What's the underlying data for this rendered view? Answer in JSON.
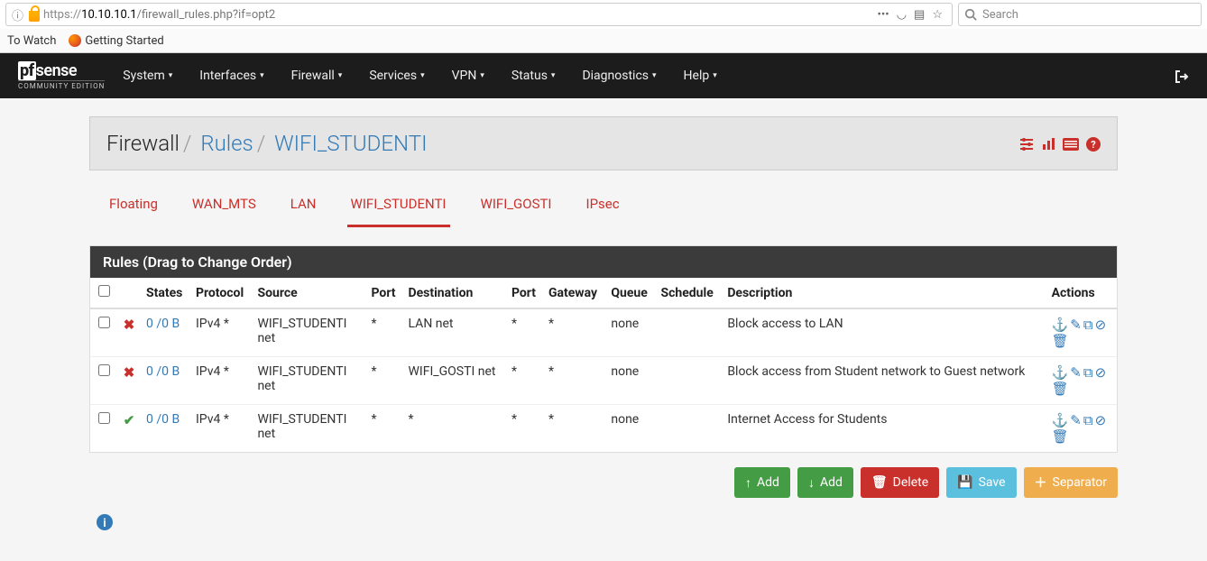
{
  "browser": {
    "url_proto": "https://",
    "url_host": "10.10.10.1",
    "url_path": "/firewall_rules.php?if=opt2",
    "search_placeholder": "Search",
    "bookmarks": [
      "To Watch",
      "Getting Started"
    ]
  },
  "nav": {
    "logo_main1": "pf",
    "logo_main2": "sense",
    "logo_sub": "COMMUNITY EDITION",
    "items": [
      "System",
      "Interfaces",
      "Firewall",
      "Services",
      "VPN",
      "Status",
      "Diagnostics",
      "Help"
    ]
  },
  "breadcrumb": {
    "root": "Firewall",
    "mid": "Rules",
    "leaf": "WIFI_STUDENTI"
  },
  "tabs": [
    "Floating",
    "WAN_MTS",
    "LAN",
    "WIFI_STUDENTI",
    "WIFI_GOSTI",
    "IPsec"
  ],
  "active_tab": "WIFI_STUDENTI",
  "panel_title": "Rules (Drag to Change Order)",
  "columns": [
    "",
    "",
    "States",
    "Protocol",
    "Source",
    "Port",
    "Destination",
    "Port",
    "Gateway",
    "Queue",
    "Schedule",
    "Description",
    "Actions"
  ],
  "rules": [
    {
      "action": "reject",
      "states": "0 /0 B",
      "protocol": "IPv4 *",
      "source": "WIFI_STUDENTI net",
      "sport": "*",
      "dest": "LAN net",
      "dport": "*",
      "gateway": "*",
      "queue": "none",
      "schedule": "",
      "description": "Block access to LAN"
    },
    {
      "action": "reject",
      "states": "0 /0 B",
      "protocol": "IPv4 *",
      "source": "WIFI_STUDENTI net",
      "sport": "*",
      "dest": "WIFI_GOSTI net",
      "dport": "*",
      "gateway": "*",
      "queue": "none",
      "schedule": "",
      "description": "Block access from Student network to Guest network"
    },
    {
      "action": "pass",
      "states": "0 /0 B",
      "protocol": "IPv4 *",
      "source": "WIFI_STUDENTI net",
      "sport": "*",
      "dest": "*",
      "dport": "*",
      "gateway": "*",
      "queue": "none",
      "schedule": "",
      "description": "Internet Access for Students"
    }
  ],
  "buttons": {
    "add_top": "Add",
    "add_bottom": "Add",
    "delete": "Delete",
    "save": "Save",
    "separator": "Separator"
  }
}
